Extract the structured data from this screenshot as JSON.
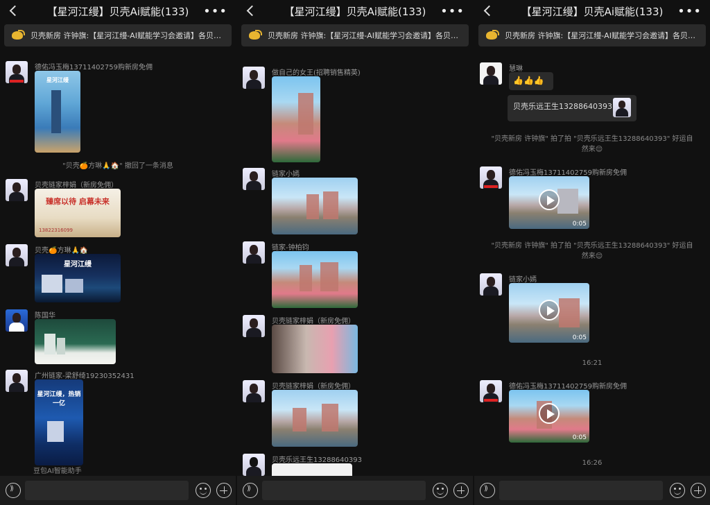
{
  "chat_title": "【星河江缦】贝壳Ai赋能(133)",
  "notice": "贝壳新房 许钟旗:【星河江缦-AI赋能学习会邀请】各贝…",
  "panel1": {
    "messages": [
      {
        "sender": "德佑冯玉梅13711402759购新房免佣",
        "poster_text": "星河江缦"
      },
      {
        "system": "\"贝壳🍊方琳🙏🏠\" 撤回了一条消息"
      },
      {
        "sender": "贝壳链家梓娟（新房免佣）",
        "poster_text": "臻席以待 启幕未来",
        "poster_phone": "13822316099"
      },
      {
        "sender": "贝壳🍊方琳🙏🏠",
        "poster_text": "星河江缦"
      },
      {
        "sender": "陈国华"
      },
      {
        "sender": "广州链家-梁舒绮19230352431",
        "poster_text": "星河江缦，热销一亿"
      }
    ],
    "footer_hint": "豆包AI智能助手"
  },
  "panel2": {
    "messages": [
      {
        "sender": "做自己的女王(招聘销售精英)"
      },
      {
        "sender": "链家小嫣"
      },
      {
        "sender": "链家-钟柏钧"
      },
      {
        "sender": "贝壳链家梓娟（新房免佣）"
      },
      {
        "sender": "贝壳链家梓娟（新房免佣）"
      },
      {
        "sender": "贝壳乐远王生13288640393"
      }
    ]
  },
  "panel3": {
    "messages": [
      {
        "sender": "慧琳",
        "emoji_text": "👍👍👍"
      },
      {
        "quote": "贝壳乐远王生13288640393:"
      },
      {
        "system": "\"贝壳新房 许钟旗\" 拍了拍 \"贝壳乐远王生13288640393\" 好运自然来😌"
      },
      {
        "sender": "德佑冯玉梅13711402759购新房免佣",
        "duration": "0:05"
      },
      {
        "system": "\"贝壳新房 许钟旗\" 拍了拍 \"贝壳乐远王生13288640393\" 好运自然来😌"
      },
      {
        "sender": "链家小嫣",
        "duration": "0:05"
      },
      {
        "time": "16:21"
      },
      {
        "sender": "德佑冯玉梅13711402759购新房免佣",
        "duration": "0:05"
      },
      {
        "time": "16:26"
      }
    ]
  }
}
